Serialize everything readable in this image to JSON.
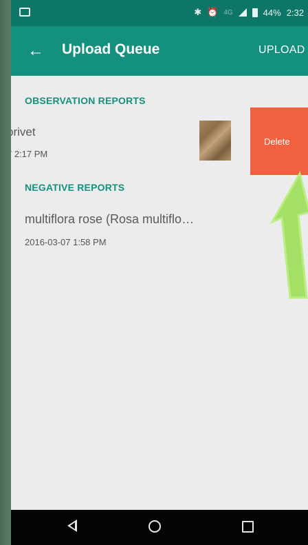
{
  "status_bar": {
    "icons": [
      "notification-icon",
      "bluetooth-icon",
      "alarm-icon",
      "signal-icon",
      "battery-icon"
    ],
    "network": "4G",
    "battery": "44%",
    "time": "2:32"
  },
  "toolbar": {
    "back_icon": "arrow-left-icon",
    "title": "Upload Queue",
    "upload_label": "UPLOAD"
  },
  "sections": {
    "observation": {
      "header": "OBSERVATION REPORTS",
      "item": {
        "title": "privet",
        "date": "7 2:17 PM"
      },
      "delete_label": "Delete"
    },
    "negative": {
      "header": "NEGATIVE REPORTS",
      "item": {
        "title": "multiflora rose (Rosa multiflo…",
        "date": "2016-03-07 1:58 PM"
      }
    }
  },
  "nav_bar": {
    "icons": [
      "back-triangle-icon",
      "home-circle-icon",
      "recents-square-icon"
    ]
  },
  "colors": {
    "status_bar": "#0e7667",
    "toolbar": "#14907f",
    "accent": "#14907f",
    "delete": "#f0613f",
    "annotation_arrow": "#9ee05a"
  }
}
